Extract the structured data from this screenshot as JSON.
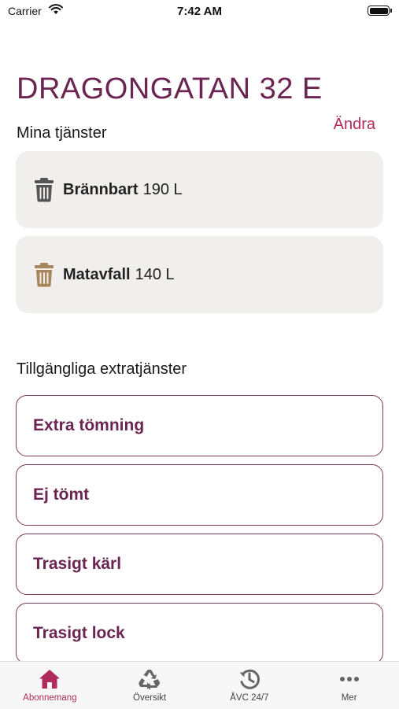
{
  "status_bar": {
    "carrier": "Carrier",
    "time": "7:42 AM"
  },
  "header": {
    "address": "DRAGONGATAN 32 E"
  },
  "my_services": {
    "title": "Mina tjänster",
    "edit_label": "Ändra",
    "items": [
      {
        "name": "Brännbart",
        "size": "190 L",
        "icon": "trash-bin-icon",
        "icon_color": "#555555"
      },
      {
        "name": "Matavfall",
        "size": "140 L",
        "icon": "trash-bin-icon",
        "icon_color": "#a6865a"
      }
    ]
  },
  "extra_services": {
    "title": "Tillgängliga extratjänster",
    "items": [
      {
        "label": "Extra tömning"
      },
      {
        "label": "Ej tömt"
      },
      {
        "label": "Trasigt kärl"
      },
      {
        "label": "Trasigt lock"
      }
    ]
  },
  "tab_bar": {
    "tabs": [
      {
        "label": "Abonnemang",
        "icon": "home-icon",
        "active": true
      },
      {
        "label": "Översikt",
        "icon": "recycle-icon",
        "active": false
      },
      {
        "label": "ÅVC 24/7",
        "icon": "clock-history-icon",
        "active": false
      },
      {
        "label": "Mer",
        "icon": "more-icon",
        "active": false
      }
    ]
  },
  "colors": {
    "brand": "#6b2551",
    "accent": "#b02a5b",
    "card_bg": "#f1efed"
  }
}
